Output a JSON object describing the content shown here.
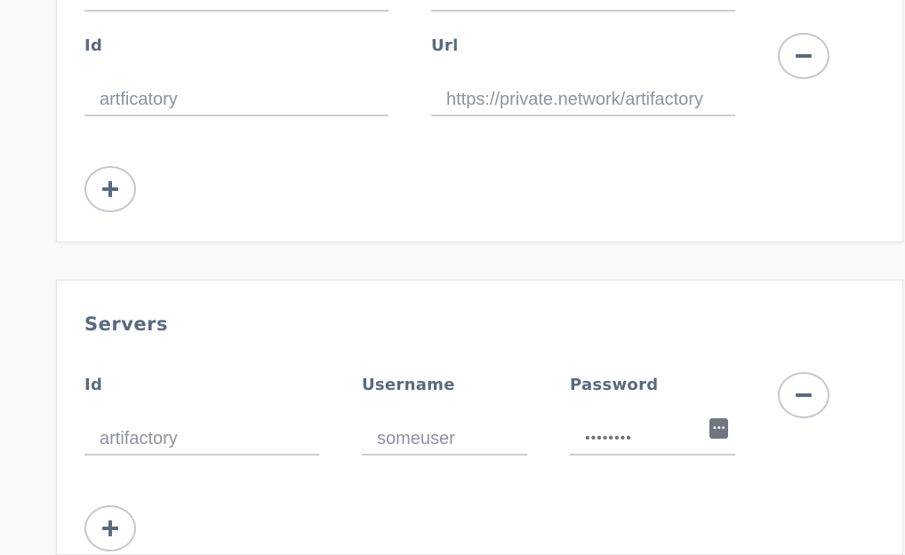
{
  "repositories": {
    "id_label": "Id",
    "url_label": "Url",
    "rows": [
      {
        "id": "artficatory",
        "url": "https://private.network/artifactory"
      }
    ],
    "remove_label": "remove",
    "add_label": "add"
  },
  "servers": {
    "title": "Servers",
    "id_label": "Id",
    "username_label": "Username",
    "password_label": "Password",
    "rows": [
      {
        "id": "artifactory",
        "username": "someuser",
        "password": "••••••••"
      }
    ],
    "remove_label": "remove",
    "add_label": "add"
  }
}
